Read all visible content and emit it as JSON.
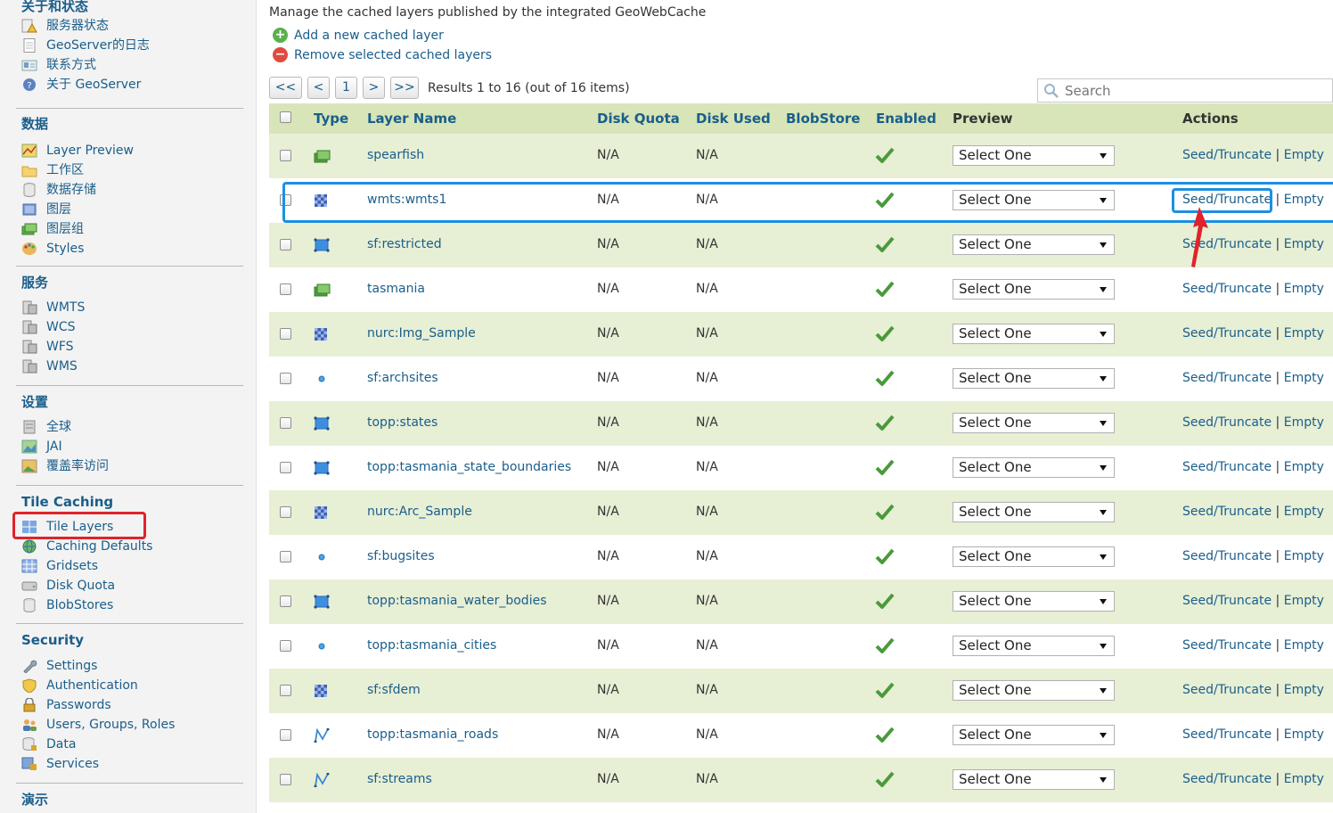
{
  "sidebar": {
    "about": {
      "title": "关于和状态",
      "items": [
        {
          "label": "服务器状态",
          "icon": "warning-icon"
        },
        {
          "label": "GeoServer的日志",
          "icon": "document-icon"
        },
        {
          "label": "联系方式",
          "icon": "contact-card-icon"
        },
        {
          "label": "关于 GeoServer",
          "icon": "help-icon"
        }
      ]
    },
    "data": {
      "title": "数据",
      "items": [
        {
          "label": "Layer Preview",
          "icon": "map-preview-icon"
        },
        {
          "label": "工作区",
          "icon": "folder-icon"
        },
        {
          "label": "数据存储",
          "icon": "database-icon"
        },
        {
          "label": "图层",
          "icon": "layer-icon"
        },
        {
          "label": "图层组",
          "icon": "layer-group-icon"
        },
        {
          "label": "Styles",
          "icon": "palette-icon"
        }
      ]
    },
    "services": {
      "title": "服务",
      "items": [
        {
          "label": "WMTS",
          "icon": "service-icon"
        },
        {
          "label": "WCS",
          "icon": "service-icon"
        },
        {
          "label": "WFS",
          "icon": "service-icon"
        },
        {
          "label": "WMS",
          "icon": "service-icon"
        }
      ]
    },
    "settings": {
      "title": "设置",
      "items": [
        {
          "label": "全球",
          "icon": "server-icon"
        },
        {
          "label": "JAI",
          "icon": "image-icon"
        },
        {
          "label": "覆盖率访问",
          "icon": "coverage-icon"
        }
      ]
    },
    "tile_caching": {
      "title": "Tile Caching",
      "items": [
        {
          "label": "Tile Layers",
          "icon": "tile-grid-icon"
        },
        {
          "label": "Caching Defaults",
          "icon": "globe-icon"
        },
        {
          "label": "Gridsets",
          "icon": "grid-icon"
        },
        {
          "label": "Disk Quota",
          "icon": "disk-icon"
        },
        {
          "label": "BlobStores",
          "icon": "database-icon"
        }
      ]
    },
    "security": {
      "title": "Security",
      "items": [
        {
          "label": "Settings",
          "icon": "wrench-icon"
        },
        {
          "label": "Authentication",
          "icon": "shield-icon"
        },
        {
          "label": "Passwords",
          "icon": "lock-icon"
        },
        {
          "label": "Users, Groups, Roles",
          "icon": "users-icon"
        },
        {
          "label": "Data",
          "icon": "data-lock-icon"
        },
        {
          "label": "Services",
          "icon": "service-lock-icon"
        }
      ]
    },
    "demo": {
      "title": "演示"
    }
  },
  "main": {
    "intro": "Manage the cached layers published by the integrated GeoWebCache",
    "add_label": "Add a new cached layer",
    "remove_label": "Remove selected cached layers",
    "pager": {
      "first": "<<",
      "prev": "<",
      "page": "1",
      "next": ">",
      "last": ">>",
      "results": "Results 1 to 16 (out of 16 items)"
    },
    "search_placeholder": "Search",
    "columns": {
      "type": "Type",
      "layer_name": "Layer Name",
      "disk_quota": "Disk Quota",
      "disk_used": "Disk Used",
      "blobstore": "BlobStore",
      "enabled": "Enabled",
      "preview": "Preview",
      "actions": "Actions"
    },
    "action_seed": "Seed/Truncate",
    "action_sep": "|",
    "action_empty": "Empty",
    "rows": [
      {
        "type": "layer-group-icon",
        "name": "spearfish",
        "disk_quota": "N/A",
        "disk_used": "N/A",
        "enabled": true,
        "preview": "Select One"
      },
      {
        "type": "raster-icon",
        "name": "wmts:wmts1",
        "disk_quota": "N/A",
        "disk_used": "N/A",
        "enabled": true,
        "preview": "Select One"
      },
      {
        "type": "polygon-icon",
        "name": "sf:restricted",
        "disk_quota": "N/A",
        "disk_used": "N/A",
        "enabled": true,
        "preview": "Select One"
      },
      {
        "type": "layer-group-icon",
        "name": "tasmania",
        "disk_quota": "N/A",
        "disk_used": "N/A",
        "enabled": true,
        "preview": "Select One"
      },
      {
        "type": "raster-icon",
        "name": "nurc:Img_Sample",
        "disk_quota": "N/A",
        "disk_used": "N/A",
        "enabled": true,
        "preview": "Select One"
      },
      {
        "type": "point-icon",
        "name": "sf:archsites",
        "disk_quota": "N/A",
        "disk_used": "N/A",
        "enabled": true,
        "preview": "Select One"
      },
      {
        "type": "polygon-icon",
        "name": "topp:states",
        "disk_quota": "N/A",
        "disk_used": "N/A",
        "enabled": true,
        "preview": "Select One"
      },
      {
        "type": "polygon-icon",
        "name": "topp:tasmania_state_boundaries",
        "disk_quota": "N/A",
        "disk_used": "N/A",
        "enabled": true,
        "preview": "Select One"
      },
      {
        "type": "raster-icon",
        "name": "nurc:Arc_Sample",
        "disk_quota": "N/A",
        "disk_used": "N/A",
        "enabled": true,
        "preview": "Select One"
      },
      {
        "type": "point-icon",
        "name": "sf:bugsites",
        "disk_quota": "N/A",
        "disk_used": "N/A",
        "enabled": true,
        "preview": "Select One"
      },
      {
        "type": "polygon-icon",
        "name": "topp:tasmania_water_bodies",
        "disk_quota": "N/A",
        "disk_used": "N/A",
        "enabled": true,
        "preview": "Select One"
      },
      {
        "type": "point-icon",
        "name": "topp:tasmania_cities",
        "disk_quota": "N/A",
        "disk_used": "N/A",
        "enabled": true,
        "preview": "Select One"
      },
      {
        "type": "raster-icon",
        "name": "sf:sfdem",
        "disk_quota": "N/A",
        "disk_used": "N/A",
        "enabled": true,
        "preview": "Select One"
      },
      {
        "type": "line-icon",
        "name": "topp:tasmania_roads",
        "disk_quota": "N/A",
        "disk_used": "N/A",
        "enabled": true,
        "preview": "Select One"
      },
      {
        "type": "line-icon",
        "name": "sf:streams",
        "disk_quota": "N/A",
        "disk_used": "N/A",
        "enabled": true,
        "preview": "Select One"
      }
    ]
  },
  "colors": {
    "link": "#1a5e8a",
    "header_bg": "#d7e5b8",
    "odd_row_bg": "#e7efd5",
    "highlight_blue": "#1e8fe1",
    "highlight_red": "#e0232b",
    "check_green": "#4a9a3b"
  }
}
